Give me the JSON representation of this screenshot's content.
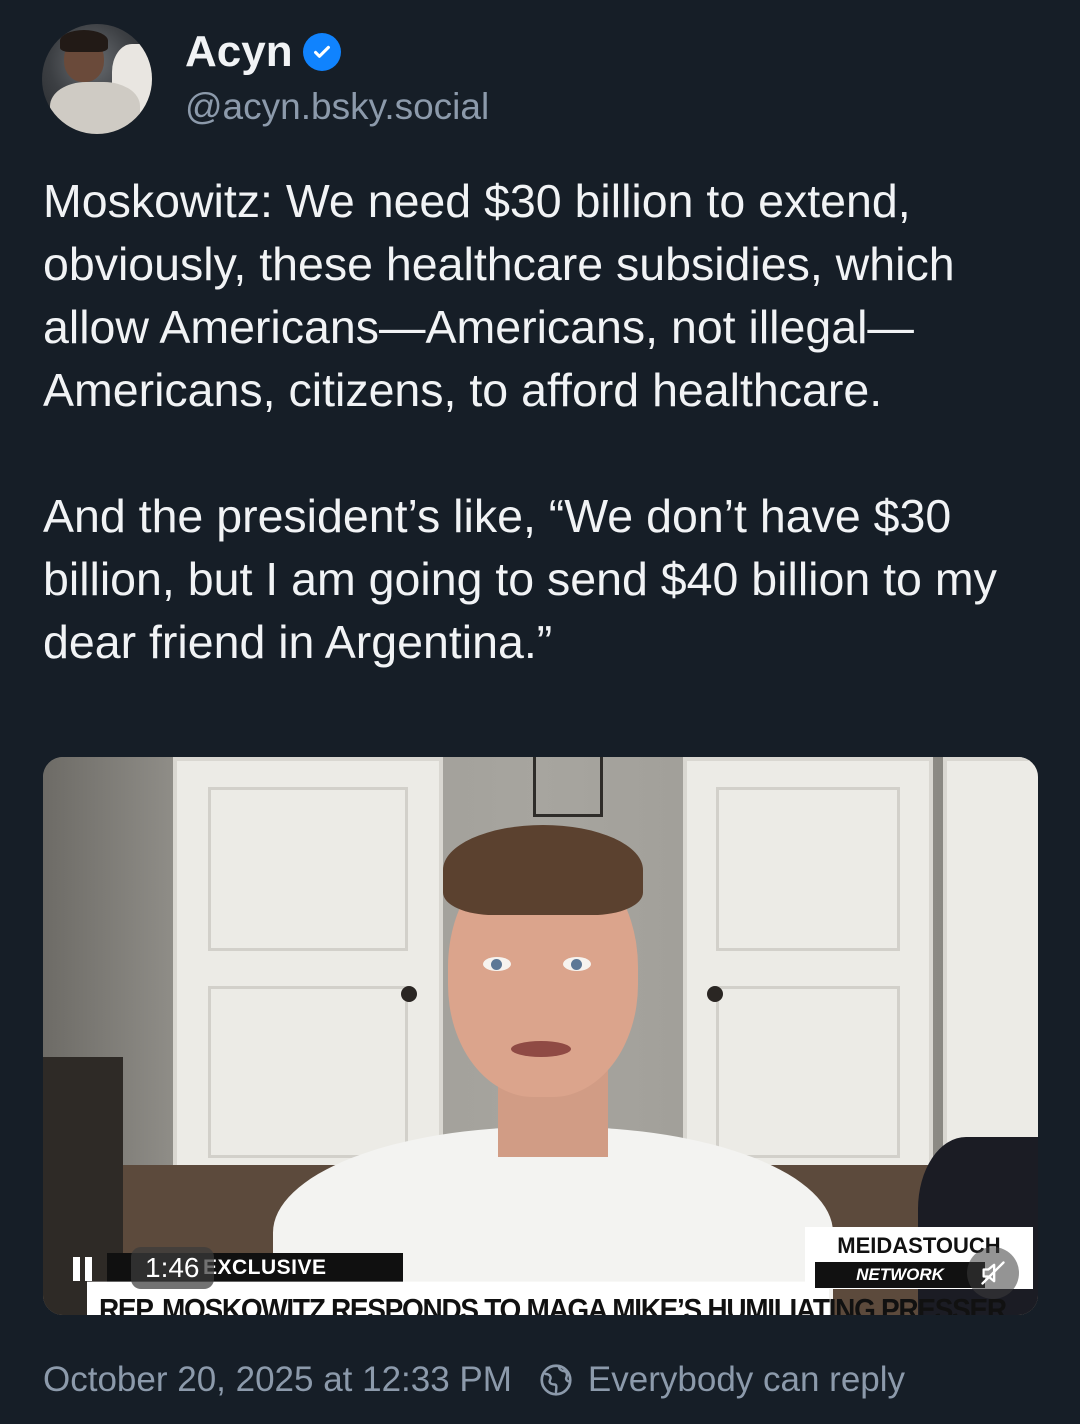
{
  "author": {
    "name": "Acyn",
    "handle": "@acyn.bsky.social",
    "verified_icon": "verified-checkmark",
    "verified_color": "#1083fe"
  },
  "post": {
    "paragraphs": [
      "Moskowitz: We need $30 billion to extend, obviously, these healthcare subsidies, which allow Americans—Americans, not illegal—Americans, citizens, to afford healthcare.",
      "And the president’s like, “We don’t have $30 billion, but I am going to send $40 billion to my dear friend in Argentina.”"
    ]
  },
  "video": {
    "exclusive_label": "EXCLUSIVE",
    "headline": "REP. MOSKOWITZ RESPONDS TO MAGA MIKE’S HUMILIATING PRESSER",
    "brand_line1": "MEIDASTOUCH",
    "brand_line2": "NETWORK",
    "duration": "1:46",
    "pause_icon": "pause-icon",
    "mute_icon": "muted-speaker-icon"
  },
  "footer": {
    "timestamp": "October 20, 2025 at 12:33 PM",
    "reply_setting": "Everybody can reply",
    "reply_icon": "globe-icon"
  },
  "colors": {
    "background": "#161e27",
    "text": "#f1f3f5",
    "muted": "#8c9aab"
  }
}
